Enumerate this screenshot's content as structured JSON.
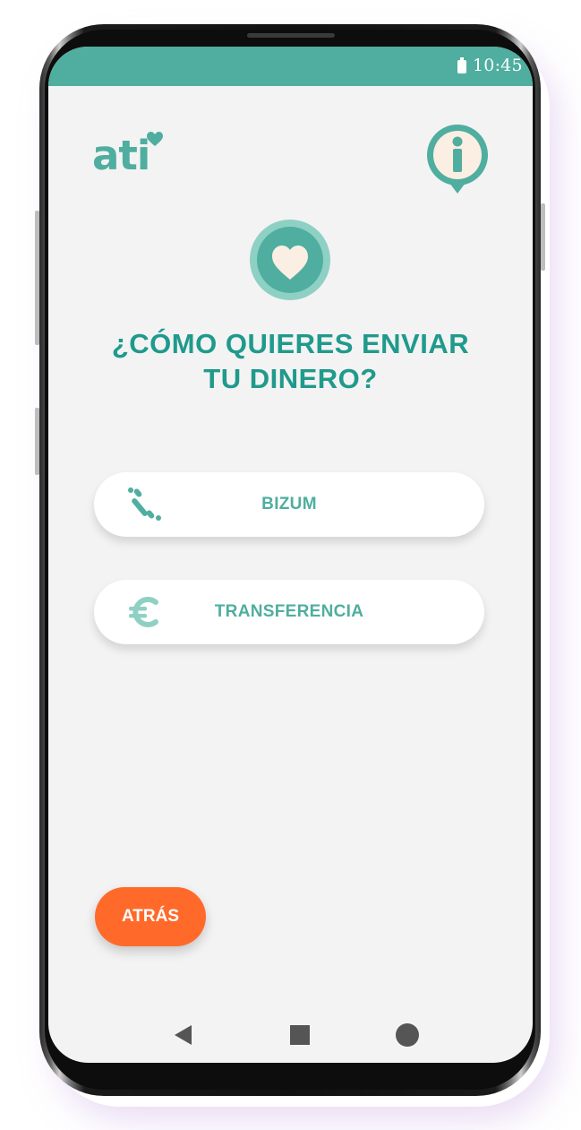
{
  "status_bar": {
    "time": "10:45",
    "battery_icon": "battery-icon"
  },
  "header": {
    "logo_text": "ati",
    "info_icon": "info-icon"
  },
  "hero": {
    "icon": "heart-icon"
  },
  "title": {
    "line1": "¿CÓMO QUIERES ENVIAR",
    "line2": "TU DINERO?"
  },
  "options": [
    {
      "label": "BIZUM",
      "icon": "bizum-icon"
    },
    {
      "label": "TRANSFERENCIA",
      "icon": "euro-icon"
    }
  ],
  "back_button": {
    "label": "ATRÁS"
  },
  "nav_bar": {
    "back": "nav-back-icon",
    "home": "nav-home-icon",
    "recents": "nav-recents-icon"
  },
  "colors": {
    "accent": "#4fae9f",
    "title": "#1f9a8c",
    "button_orange": "#ff6a2b",
    "background": "#f3f3f3",
    "cream": "#fbeee3"
  }
}
